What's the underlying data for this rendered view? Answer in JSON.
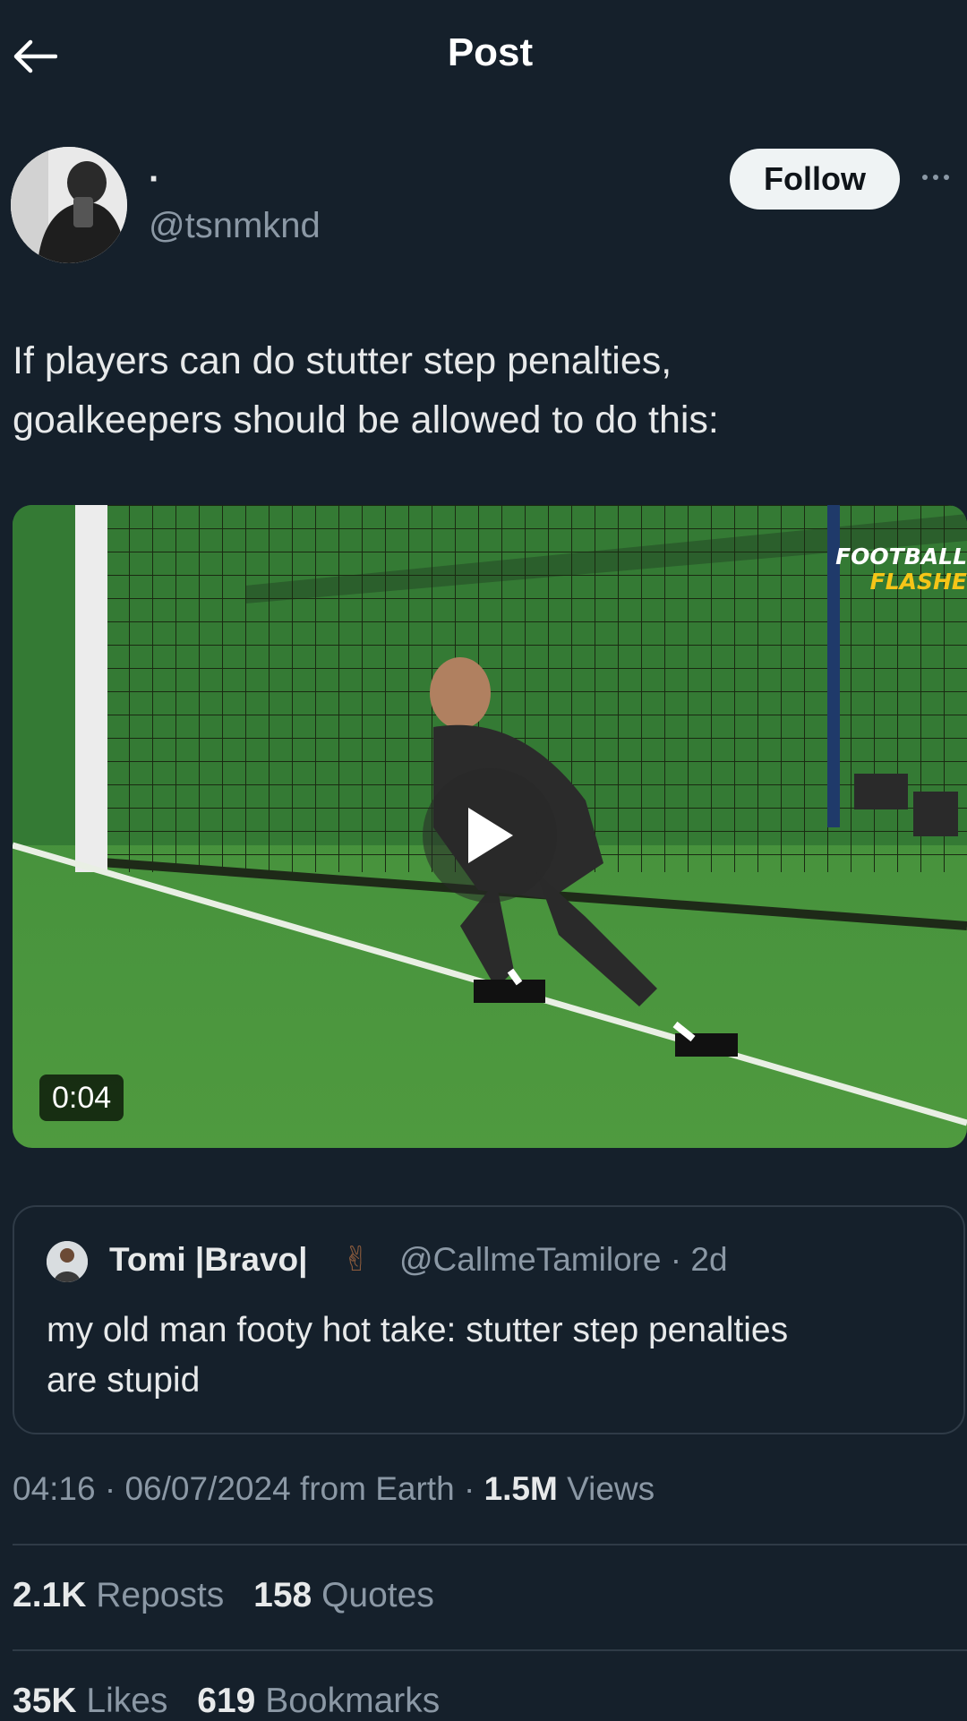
{
  "header": {
    "title": "Post",
    "back_icon": "arrow-left-icon"
  },
  "author": {
    "display_name": "·",
    "handle": "@tsnmknd",
    "follow_label": "Follow"
  },
  "post": {
    "text_line1": "If players can do stutter step penalties,",
    "text_line2": "goalkeepers should be allowed to do this:"
  },
  "video": {
    "duration": "0:04",
    "watermark_line1": "FOOTBALL",
    "watermark_line2": "FLASHE",
    "watermark_colors": [
      "#ffffff",
      "#f5c518"
    ]
  },
  "quote": {
    "name": "Tomi |Bravo|",
    "emoji": "✌",
    "handle": "@CallmeTamilore",
    "separator": "·",
    "age": "2d",
    "text_line1": "my old man footy hot take: stutter step penalties",
    "text_line2": "are stupid"
  },
  "meta": {
    "time": "04:16",
    "date": "06/07/2024",
    "location": "from Earth",
    "views_count": "1.5M",
    "views_label": "Views"
  },
  "stats": {
    "reposts_count": "2.1K",
    "reposts_label": "Reposts",
    "quotes_count": "158",
    "quotes_label": "Quotes",
    "likes_count": "35K",
    "likes_label": "Likes",
    "bookmarks_count": "619",
    "bookmarks_label": "Bookmarks"
  },
  "colors": {
    "background": "#15202b",
    "text": "#e7e9ea",
    "secondary_text": "#8b98a5",
    "divider": "#2f3b47"
  }
}
